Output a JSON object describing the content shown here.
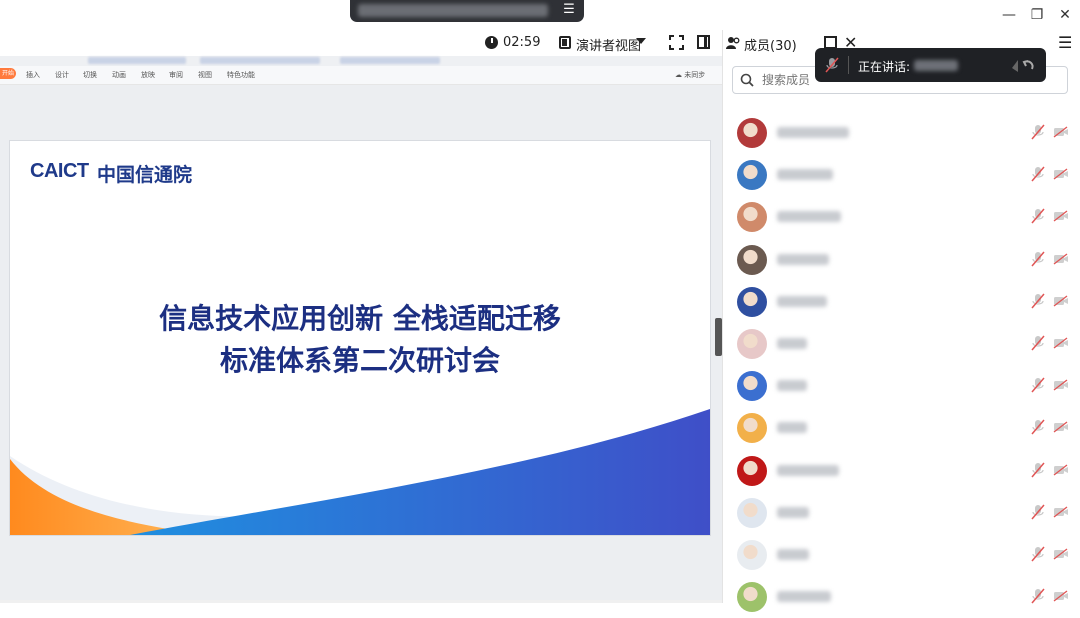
{
  "window": {
    "minimize_glyph": "—",
    "restore_glyph": "❐",
    "close_glyph": "✕",
    "share_menu_glyph": "☰"
  },
  "toolbar": {
    "timer": "02:59",
    "view_mode": "演讲者视图"
  },
  "ppt": {
    "start_tab": "开始",
    "ribbon": [
      "插入",
      "设计",
      "切换",
      "动画",
      "放映",
      "审阅",
      "视图",
      "特色功能"
    ],
    "sync": "未同步"
  },
  "slide": {
    "logo_en": "CAICT",
    "logo_cn": "中国信通院",
    "title_line1": "信息技术应用创新 全栈适配迁移",
    "title_line2": "标准体系第二次研讨会"
  },
  "members": {
    "title": "成员(30)",
    "search_placeholder": "搜索成员",
    "close_glyph": "✕",
    "menu_glyph": "☰",
    "speaking_label": "正在讲话:",
    "list": [
      {
        "name_width": 72,
        "avatar": "#b23a3a"
      },
      {
        "name_width": 56,
        "avatar": "#3a78c2"
      },
      {
        "name_width": 64,
        "avatar": "#d08a6a"
      },
      {
        "name_width": 52,
        "avatar": "#6b5a50"
      },
      {
        "name_width": 50,
        "avatar": "#2f4fa0"
      },
      {
        "name_width": 30,
        "avatar": "#e7c8c8"
      },
      {
        "name_width": 30,
        "avatar": "#3b6fd0"
      },
      {
        "name_width": 30,
        "avatar": "#f2b04a"
      },
      {
        "name_width": 62,
        "avatar": "#c01818"
      },
      {
        "name_width": 32,
        "avatar": "#dfe6ef"
      },
      {
        "name_width": 32,
        "avatar": "#e8ecf0"
      },
      {
        "name_width": 54,
        "avatar": "#9dc26a"
      }
    ]
  },
  "colors": {
    "accent_blue": "#1c2f82",
    "wave_orange": "#ff8a2a",
    "wave_blue": "#2d6fd6",
    "muted_red": "#e05555"
  }
}
